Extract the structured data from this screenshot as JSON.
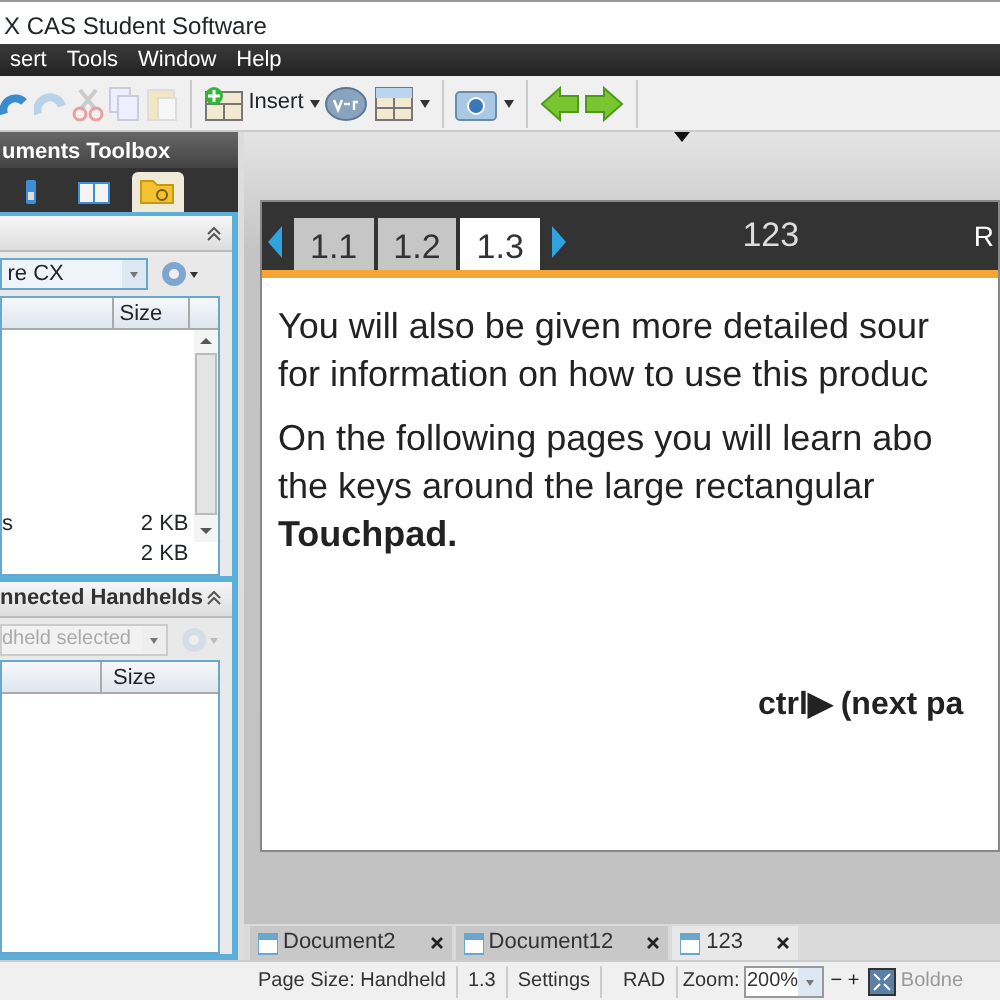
{
  "window": {
    "title": "X CAS Student Software"
  },
  "menu": [
    {
      "label": "sert"
    },
    {
      "label": "Tools"
    },
    {
      "label": "Window"
    },
    {
      "label": "Help"
    }
  ],
  "toolbar": {
    "insert_button": "Insert"
  },
  "toolbox": {
    "title": "uments Toolbox",
    "tabs": [
      {
        "kind": "handheld",
        "selected": false
      },
      {
        "kind": "book",
        "selected": false
      },
      {
        "kind": "folder",
        "selected": true
      }
    ]
  },
  "computer_section": {
    "dropdown": "re CX",
    "columns": [
      "Size"
    ],
    "rows": [
      {
        "name": "s",
        "size": "2 KB"
      },
      {
        "name": "",
        "size": "2 KB"
      }
    ]
  },
  "handhelds_section": {
    "title": "nnected Handhelds",
    "dropdown": "dheld selected",
    "columns": [
      "Size"
    ]
  },
  "page_tabs": [
    {
      "label": "1.1",
      "selected": false
    },
    {
      "label": "1.2",
      "selected": false
    },
    {
      "label": "1.3",
      "selected": true
    }
  ],
  "problem_label": "123",
  "right_label": "R",
  "page_content": {
    "lines": [
      "You will also be given more detailed sour",
      "for information on how to use this produc",
      "On the following pages you will learn abo",
      "the keys around the large rectangular",
      "Touchpad."
    ],
    "hint": "ctrl▶ (next pa"
  },
  "document_tabs": [
    {
      "label": "Document2",
      "selected": false
    },
    {
      "label": "Document12",
      "selected": false
    },
    {
      "label": "123",
      "selected": true
    }
  ],
  "status_bar": {
    "page_size": "Page Size: Handheld",
    "page": "1.3",
    "settings": "Settings",
    "angle": "RAD",
    "zoom_label": "Zoom:",
    "zoom": "200%",
    "minus": "−",
    "plus": "+",
    "right": "Boldne"
  }
}
